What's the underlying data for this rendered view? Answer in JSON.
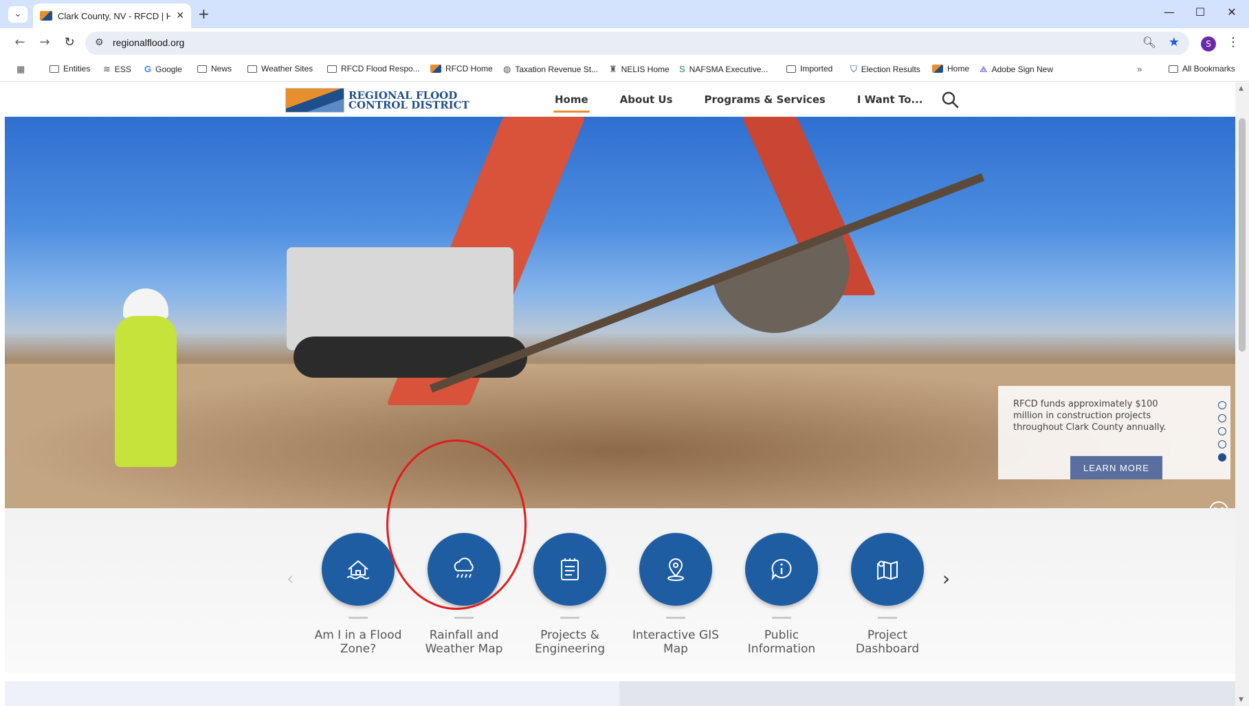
{
  "browser": {
    "tab_title": "Clark County, NV - RFCD | Hom",
    "url": "regionalflood.org",
    "profile_initial": "S"
  },
  "bookmarks": [
    {
      "label": "Entities",
      "icon": "folder-icon"
    },
    {
      "label": "ESS",
      "icon": "ess-icon"
    },
    {
      "label": "Google",
      "icon": "google-icon"
    },
    {
      "label": "News",
      "icon": "folder-icon"
    },
    {
      "label": "Weather Sites",
      "icon": "folder-icon"
    },
    {
      "label": "RFCD Flood Respo...",
      "icon": "folder-icon"
    },
    {
      "label": "RFCD Home",
      "icon": "rfcd-flag-icon"
    },
    {
      "label": "Taxation Revenue St...",
      "icon": "globe-icon"
    },
    {
      "label": "NELIS Home",
      "icon": "nelis-icon"
    },
    {
      "label": "NAFSMA Executive...",
      "icon": "nafsma-icon"
    },
    {
      "label": "Imported",
      "icon": "folder-icon"
    },
    {
      "label": "Election Results",
      "icon": "shield-icon"
    },
    {
      "label": "Home",
      "icon": "rfcd-flag-icon"
    },
    {
      "label": "Adobe Sign New",
      "icon": "adobe-icon"
    }
  ],
  "all_bookmarks": "All Bookmarks",
  "site": {
    "logo_line1": "REGIONAL FLOOD",
    "logo_line2": "CONTROL DISTRICT",
    "nav": [
      "Home",
      "About Us",
      "Programs & Services",
      "I Want To..."
    ]
  },
  "hero": {
    "callout_text": "RFCD funds approximately $100 million in construction projects throughout Clark County annually.",
    "learn_more": "LEARN MORE",
    "slide_count": 5,
    "active_slide": 5
  },
  "quicklinks": [
    {
      "line1": "Am I in a Flood",
      "line2": "Zone?",
      "icon": "house-flood-icon"
    },
    {
      "line1": "Rainfall and",
      "line2": "Weather Map",
      "icon": "rain-cloud-icon"
    },
    {
      "line1": "Projects &",
      "line2": "Engineering",
      "icon": "clipboard-list-icon"
    },
    {
      "line1": "Interactive GIS",
      "line2": "Map",
      "icon": "map-pin-icon"
    },
    {
      "line1": "Public",
      "line2": "Information",
      "icon": "info-bubble-icon"
    },
    {
      "line1": "Project",
      "line2": "Dashboard",
      "icon": "folded-map-icon"
    }
  ],
  "colors": {
    "brand_blue": "#1f5da3",
    "brand_orange": "#e88f2d",
    "annotation_red": "#e21b1b"
  }
}
